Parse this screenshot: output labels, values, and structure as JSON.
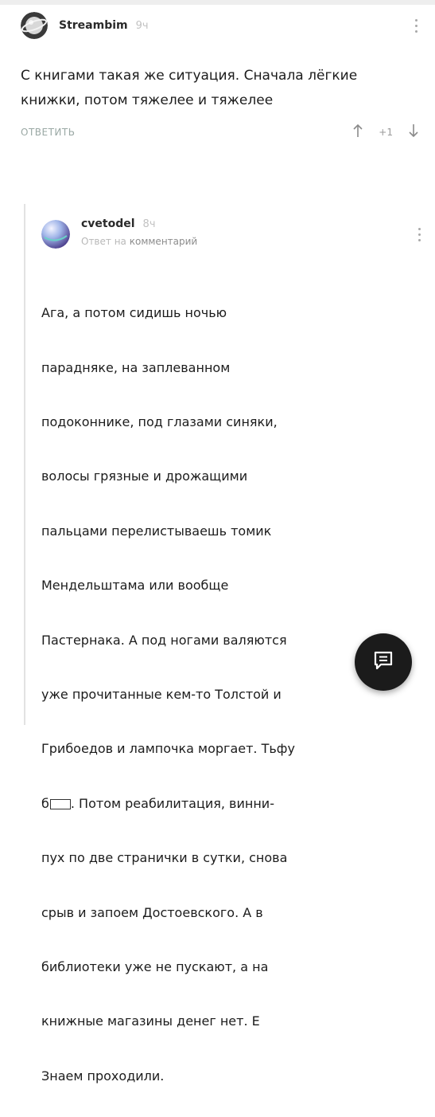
{
  "comment1": {
    "username": "Streambim",
    "time": "9ч",
    "text": "С книгами такая же ситуация. Сначала лёгкие книжки, потом тяжелее и тяжелее",
    "reply_label": "ОТВЕТИТЬ",
    "score": "+1",
    "avatar_icon": "planet-avatar-icon",
    "menu_icon": "more-vertical-icon"
  },
  "comment2": {
    "username": "cvetodel",
    "time": "8ч",
    "reply_prefix": "Ответ на",
    "reply_target": "комментарий",
    "text_lines": [
      "Ага, а потом сидишь ночью",
      "парадняке, на заплеванном",
      "подоконнике, под глазами синяки,",
      "волосы грязные  и дрожащими",
      "пальцами перелистываешь томик",
      "Мендельштама или вообще",
      "Пастернака. А под ногами валяются",
      "уже прочитанные кем-то Толстой и",
      "Грибоедов и лампочка моргает. Тьфу"
    ],
    "censored_prefix": "б",
    "text_after_censor": ". Потом реабилитация, винни-",
    "text_lines_tail": [
      "пух по две странички в сутки, снова",
      "срыв и запоем Достоевского. А в",
      "библиотеки уже не пускают, а на",
      "книжные магазины денег нет. Е",
      "Знаем проходили."
    ],
    "avatar_icon": "sphere-avatar-icon",
    "menu_icon": "more-vertical-icon"
  },
  "fab": {
    "icon": "comment-icon"
  },
  "colors": {
    "text": "#1c1c1c",
    "muted": "#9a9a9a",
    "reply_link": "#9aa8a4",
    "thread_line": "#e2e2e2",
    "fab": "#1b1b1b"
  }
}
